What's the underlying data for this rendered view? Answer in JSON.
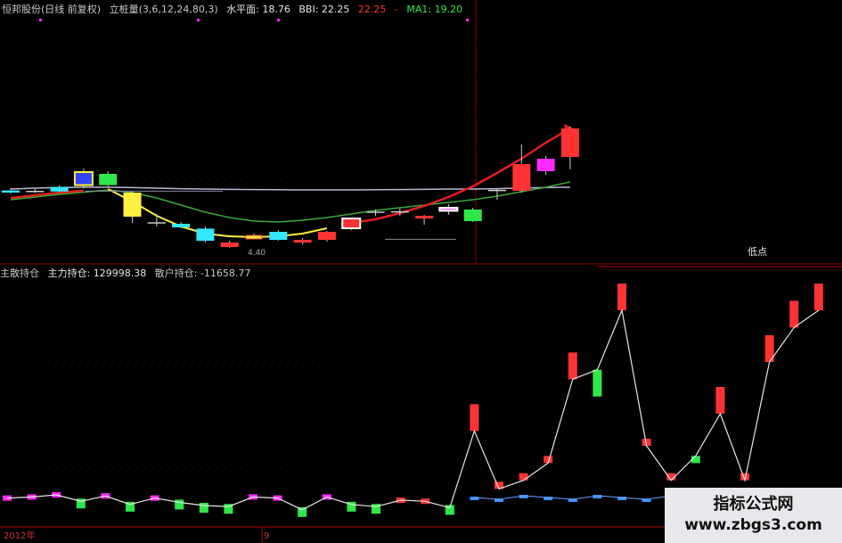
{
  "header": {
    "stock": "恒邦股份(日线 前复权)",
    "indicator": "立桩量(3,6,12,24,80,3)",
    "level": "水平面: 18.76",
    "bbi": "BBI: 22.25",
    "val": "22.25",
    "dash": "-",
    "ma1": "MA1: 19.20"
  },
  "lower_header": {
    "zhusan": "主散持仓",
    "zhuli": "主力持仓: 129998.38",
    "sanhu": "散户持仓: -11658.77"
  },
  "label_didian": "低点",
  "candle_note": "4.40",
  "axis": {
    "year": "2012年",
    "month": "9"
  },
  "watermark": {
    "title": "指标公式网",
    "url": "www.zbgs3.com"
  },
  "colors": {
    "up": "#ff3333",
    "down": "#35e8ff",
    "yellow": "#ffef40",
    "magenta": "#ff2aff",
    "green": "#2ee84a",
    "grid": "#7a0000"
  },
  "chart_data": [
    {
      "type": "candlestick",
      "candles": [
        {
          "o": 18.82,
          "h": 18.95,
          "l": 18.65,
          "c": 18.7,
          "style": "down"
        },
        {
          "o": 18.78,
          "h": 18.9,
          "l": 18.68,
          "c": 18.76,
          "style": "doji"
        },
        {
          "o": 18.76,
          "h": 19.12,
          "l": 18.72,
          "c": 19.02,
          "style": "down"
        },
        {
          "o": 19.12,
          "h": 20.05,
          "l": 18.95,
          "c": 19.85,
          "style": "yellowbox"
        },
        {
          "o": 19.75,
          "h": 19.9,
          "l": 19.05,
          "c": 19.12,
          "style": "green"
        },
        {
          "o": 18.7,
          "h": 18.8,
          "l": 17.0,
          "c": 17.35,
          "style": "yellow"
        },
        {
          "o": 17.35,
          "h": 17.5,
          "l": 16.8,
          "c": 17.0,
          "style": "doji"
        },
        {
          "o": 16.95,
          "h": 17.05,
          "l": 16.7,
          "c": 16.75,
          "style": "down"
        },
        {
          "o": 16.68,
          "h": 16.8,
          "l": 15.9,
          "c": 16.0,
          "style": "down"
        },
        {
          "o": 15.9,
          "h": 16.0,
          "l": 15.6,
          "c": 15.65,
          "style": "upbar"
        },
        {
          "o": 16.3,
          "h": 16.42,
          "l": 16.15,
          "c": 16.2,
          "style": "yellowdash"
        },
        {
          "o": 16.5,
          "h": 16.6,
          "l": 16.0,
          "c": 16.05,
          "style": "down"
        },
        {
          "o": 16.05,
          "h": 16.15,
          "l": 15.8,
          "c": 15.9,
          "style": "upbar"
        },
        {
          "o": 16.05,
          "h": 16.55,
          "l": 15.95,
          "c": 16.5,
          "style": "up"
        },
        {
          "o": 16.7,
          "h": 17.3,
          "l": 16.6,
          "c": 17.25,
          "style": "upbox"
        },
        {
          "o": 17.6,
          "h": 17.75,
          "l": 17.4,
          "c": 17.6,
          "style": "doji"
        },
        {
          "o": 17.55,
          "h": 17.8,
          "l": 17.4,
          "c": 17.62,
          "style": "doji"
        },
        {
          "o": 17.25,
          "h": 17.45,
          "l": 16.9,
          "c": 17.4,
          "style": "up"
        },
        {
          "o": 17.68,
          "h": 18.05,
          "l": 17.45,
          "c": 17.85,
          "style": "magentabox"
        },
        {
          "o": 17.75,
          "h": 17.85,
          "l": 17.05,
          "c": 17.1,
          "style": "green"
        },
        {
          "o": 18.8,
          "h": 18.95,
          "l": 18.3,
          "c": 18.82,
          "style": "doji"
        },
        {
          "o": 18.8,
          "h": 21.4,
          "l": 18.7,
          "c": 20.3,
          "style": "up"
        },
        {
          "o": 19.9,
          "h": 20.75,
          "l": 19.7,
          "c": 20.6,
          "style": "magenta"
        },
        {
          "o": 20.7,
          "h": 22.4,
          "l": 20.0,
          "c": 22.3,
          "style": "up"
        }
      ],
      "lines": {
        "bbi": [
          18.9,
          18.95,
          18.98,
          19.0,
          19.0,
          18.98,
          18.95,
          18.92,
          18.9,
          18.88,
          18.87,
          18.86,
          18.85,
          18.85,
          18.85,
          18.86,
          18.87,
          18.88,
          18.9,
          18.9,
          18.92,
          18.96,
          18.98,
          19.0
        ],
        "ma1": [
          18.3,
          18.45,
          18.6,
          18.72,
          18.85,
          18.7,
          18.4,
          18.0,
          17.6,
          17.3,
          17.1,
          17.05,
          17.15,
          17.3,
          17.5,
          17.7,
          17.85,
          18.0,
          18.15,
          18.3,
          18.5,
          18.75,
          19.0,
          19.3
        ],
        "red": [
          18.4,
          18.55,
          18.7,
          18.8,
          null,
          null,
          null,
          null,
          null,
          null,
          null,
          null,
          null,
          null,
          17.0,
          17.2,
          17.55,
          17.95,
          18.45,
          19.05,
          19.8,
          20.6,
          21.5,
          22.3
        ],
        "yellow": [
          null,
          null,
          null,
          null,
          18.9,
          18.2,
          17.4,
          16.8,
          16.4,
          16.25,
          16.2,
          16.25,
          16.4,
          16.7,
          null,
          null,
          null,
          null,
          null,
          null,
          null,
          null,
          null,
          null
        ]
      }
    },
    {
      "type": "bar",
      "series": [
        {
          "values": [
            0,
            0,
            0,
            0,
            0,
            0,
            0,
            0,
            0,
            0,
            0,
            0,
            0,
            0,
            0,
            0,
            0,
            0,
            0,
            5,
            0.5,
            1,
            2,
            8,
            7,
            12,
            3,
            1,
            2,
            6,
            1,
            9,
            11,
            12
          ],
          "colors": [
            "magenta",
            "magenta",
            "magenta",
            "green",
            "magenta",
            "green",
            "magenta",
            "green",
            "green",
            "green",
            "magenta",
            "magenta",
            "green",
            "magenta",
            "green",
            "green",
            "up",
            "up",
            "green",
            "up",
            "up",
            "up",
            "up",
            "up",
            "green",
            "up",
            "up",
            "up",
            "green",
            "up",
            "up",
            "up",
            "up",
            "up"
          ]
        }
      ],
      "ylim": [
        -1,
        13
      ]
    }
  ]
}
